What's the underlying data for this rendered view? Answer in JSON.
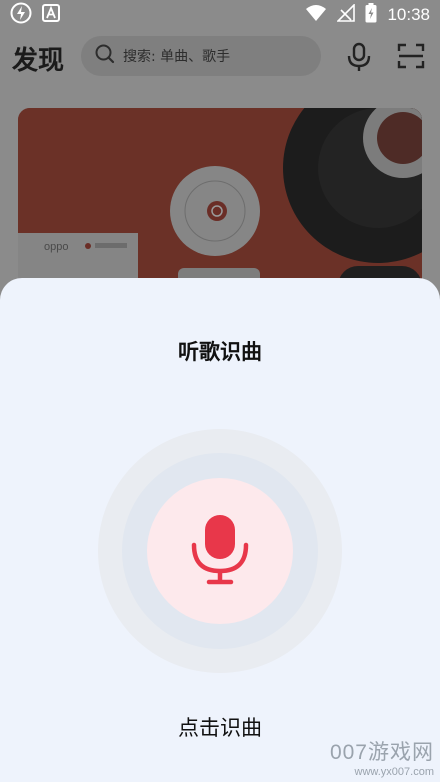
{
  "status_bar": {
    "time": "10:38",
    "left_icons": [
      "flash-icon",
      "app-a-icon"
    ],
    "right_icons": [
      "wifi-icon",
      "signal-icon",
      "battery-icon"
    ]
  },
  "header": {
    "title": "发现",
    "search": {
      "placeholder": "搜索: 单曲、歌手",
      "icon": "search-icon"
    },
    "actions": [
      "mic-icon",
      "scan-icon"
    ]
  },
  "banner": {
    "brand_text": "oppo"
  },
  "sheet": {
    "title": "听歌识曲",
    "caption": "点击识曲",
    "accent_color": "#e8374a"
  },
  "watermark": {
    "main": "007游戏网",
    "url": "www.yx007.com"
  }
}
